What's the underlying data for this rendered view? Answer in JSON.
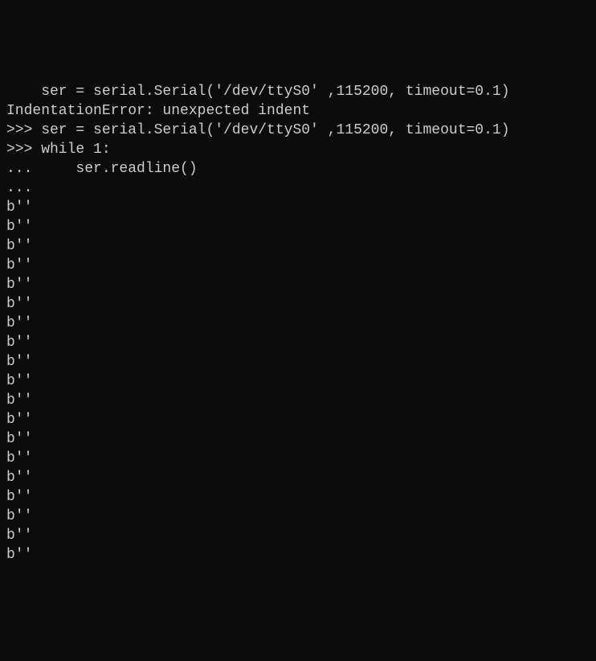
{
  "terminal": {
    "lines": [
      "    ser = serial.Serial('/dev/ttyS0' ,115200, timeout=0.1)",
      "IndentationError: unexpected indent",
      ">>> ser = serial.Serial('/dev/ttyS0' ,115200, timeout=0.1)",
      ">>> while 1:",
      "...     ser.readline()",
      "...",
      "b''",
      "b''",
      "b''",
      "b''",
      "b''",
      "b''",
      "b''",
      "b''",
      "b''",
      "b''",
      "b''",
      "b''",
      "b''",
      "b''",
      "b''",
      "b''",
      "b''",
      "b''",
      "b''"
    ]
  }
}
